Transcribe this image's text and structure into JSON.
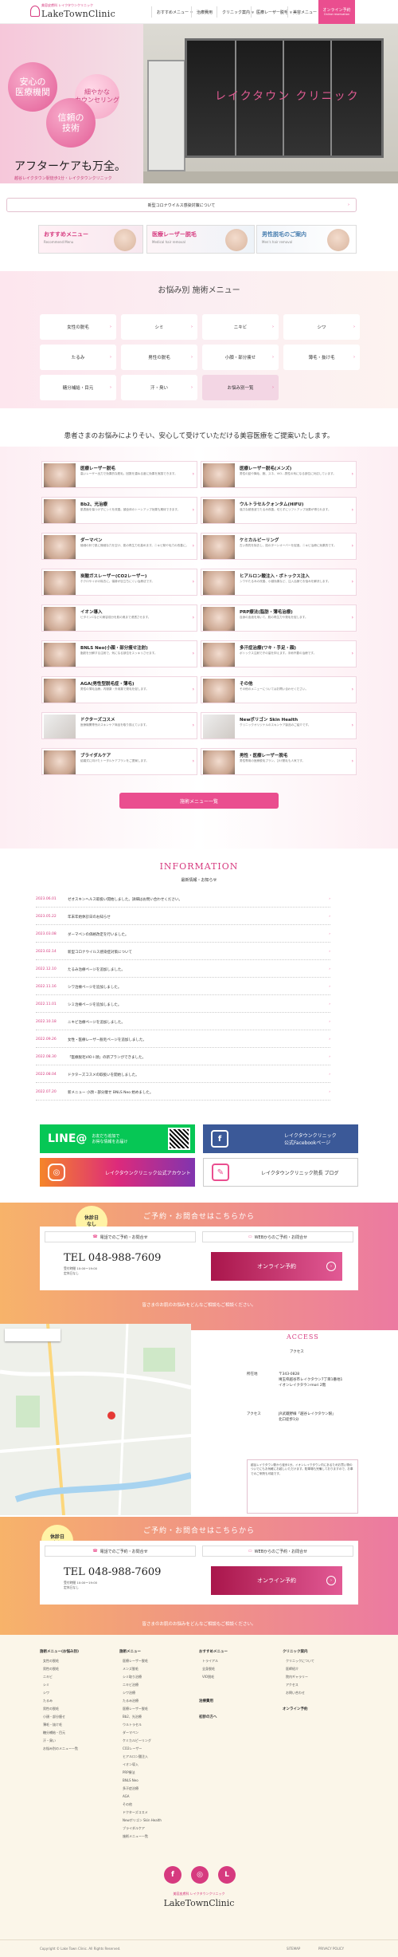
{
  "header": {
    "logo_sub": "美容皮膚科 レイクタウンクリニック",
    "logo": "LakeTownClinic",
    "nav": [
      "おすすめメニュー",
      "治療費用",
      "クリニック案内",
      "医療レーザー脱毛",
      "美容メニュー"
    ],
    "cta": [
      "オンライン予約",
      "Online reservation"
    ]
  },
  "hero": {
    "sign": "レイクタウン クリニック",
    "bubble1": "安心の\n医療機関",
    "bubble2": "細やかな\nカウンセリング",
    "bubble3": "信頼の\n技術",
    "copy": "アフターケアも万全。",
    "copy2": "越谷レイクタウン駅徒歩1分・レイクタウンクリニック"
  },
  "notice": "新型コロナウイルス感染対策について",
  "banners": [
    {
      "t": "おすすめメニュー",
      "s": "Recommend Menu"
    },
    {
      "t": "医療レーザー脱毛",
      "s": "Medical hair removal"
    },
    {
      "t": "男性脱毛のご案内",
      "s": "Men's hair removal"
    }
  ],
  "menu": {
    "title": "お悩み別 施術メニュー",
    "items": [
      "女性の脱毛",
      "シミ",
      "ニキビ",
      "シワ",
      "たるみ",
      "男性の脱毛",
      "小顔・部分痩せ",
      "薄毛・抜け毛",
      "糖分補給・目元",
      "汗・臭い",
      "お悩み別一覧"
    ]
  },
  "proposal": "患者さまのお悩みによりそい、安心して受けていただける美容医療をご提案いたします。",
  "treatments": [
    {
      "n": "医療レーザー脱毛",
      "d": "高いレーザー出力で効果的な脱毛。回数を重ねる度に効果を実感できます。"
    },
    {
      "n": "医療レーザー脱毛(メンズ)",
      "d": "男性の髭や胸毛、腕、スネ、VIO…男性の気になる部位に対応しています。"
    },
    {
      "n": "Bb2、光治療",
      "d": "肌表面を傷つけずにシミを改善。顔全体のトーンアップ効果も期待できます。"
    },
    {
      "n": "ウルトラセルクォンタム(HIFU)",
      "d": "強力な超音波でたるみ改善。切らずにリフトアップ効果が得られます。"
    },
    {
      "n": "ダーマペン",
      "d": "極細の針で肌に微細な穴を空け、肌の再生力を高めます。ニキビ跡や毛穴の改善に。"
    },
    {
      "n": "ケミカルピーリング",
      "d": "古い角質を除去し、肌のターンオーバーを促進。ニキビ治療に効果的です。"
    },
    {
      "n": "炭酸ガスレーザー(CO2レーザー)",
      "d": "ホクロやイボの除去に。傷跡が目立ちにくい治療法です。"
    },
    {
      "n": "ヒアルロン酸注入・ボトックス注入",
      "d": "シワやたるみの改善、小顔効果など、注入治療でお悩みを解決します。"
    },
    {
      "n": "イオン導入",
      "d": "ビタミンCなどの美容成分を肌の奥まで浸透させます。"
    },
    {
      "n": "PRP療法(脂肪・薄毛治療)",
      "d": "自身の血液を用いて、肌の再生力や発毛を促します。"
    },
    {
      "n": "BNLS Neo(小顔・部分痩せ注射)",
      "d": "脂肪を分解する注射で、気になる部位をスッキリさせます。"
    },
    {
      "n": "多汗症治療(ワキ・手足・顔)",
      "d": "ボトックス注射で汗の量を抑えます。手術不要の治療です。"
    },
    {
      "n": "AGA(男性型脱毛症・薄毛)",
      "d": "男性の薄毛治療。内服薬・外用薬で発毛を促します。"
    },
    {
      "n": "その他",
      "d": "その他のメニューについてはお問い合わせください。"
    },
    {
      "n": "ドクターズコスメ",
      "d": "医療機関専売のスキンケア商品を取り揃えています。"
    },
    {
      "n": "Newポリゴン Skin Health",
      "d": "クリニックオリジナルのスキンケア製品のご紹介です。"
    },
    {
      "n": "ブライダルケア",
      "d": "結婚式に向けたトータルケアプランをご提案します。"
    },
    {
      "n": "男性・医療レーザー脱毛",
      "d": "男性専用の医療脱毛プラン。ひげ脱毛も人気です。"
    }
  ],
  "treat_all": "施術メニュー一覧",
  "info": {
    "title": "INFORMATION",
    "sub": "最新情報・お知らせ",
    "news": [
      {
        "d": "2023.06.01",
        "t": "ゼオスキンヘルス取扱い開始しました。詳細はお問い合わせください。"
      },
      {
        "d": "2023.05.22",
        "t": "年末年始休診日のお知らせ"
      },
      {
        "d": "2023.03.08",
        "t": "ダーマペンの価格改定を行いました。"
      },
      {
        "d": "2023.02.14",
        "t": "新型コロナウイルス感染症対策について"
      },
      {
        "d": "2022.12.10",
        "t": "たるみ治療ページを追加しました。"
      },
      {
        "d": "2022.11.16",
        "t": "シワ治療ページを追加しました。"
      },
      {
        "d": "2022.11.01",
        "t": "シミ治療ページを追加しました。"
      },
      {
        "d": "2022.10.18",
        "t": "ニキビ治療ページを追加しました。"
      },
      {
        "d": "2022.09.26",
        "t": "女性・医療レーザー脱毛ページを追加しました。"
      },
      {
        "d": "2022.08.30",
        "t": "「医療脱毛VIO＋顔」の新プランができました。"
      },
      {
        "d": "2022.08.04",
        "t": "ドクターズコスメの取扱いを開始しました。"
      },
      {
        "d": "2022.07.20",
        "t": "新メニュー 小顔・部分痩せ BNLS Neo 始めました。"
      }
    ]
  },
  "sns": {
    "line": "LINE@",
    "line_sub": "お友だち追加で\nお得な情報をお届け",
    "fb": "レイクタウンクリニック\n公式Facebookページ",
    "ig": "レイクタウンクリニック公式アカウント",
    "blog": "レイクタウンクリニック院長 ブログ"
  },
  "contact": {
    "holiday": "休診日\nなし",
    "heading": "ご予約・お問合せはこちらから",
    "tab1": "電話でのご予約・お問合せ",
    "tab2": "WEBからのご予約・お問合せ",
    "tel": "TEL 048-988-7609",
    "hours": "受付時間 10:00～19:00\n定休日なし",
    "online": "オンライン予約",
    "foot": "皆さまのお肌のお悩みをどんなご相談もご相談ください。"
  },
  "access": {
    "title": "ACCESS",
    "name": "アクセス",
    "addr_label": "所在地",
    "addr": "〒343-0828\n埼玉県越谷市レイクタウン7丁目1番地1\nイオンレイクタウンmori 2階",
    "route_label": "アクセス",
    "route": "JR武蔵野線「越谷レイクタウン駅」\n北口徒歩1分",
    "note": "越谷レイクタウン駅から徒歩1分。イオンレイクタウン内にあるためお買い物のついでにもお気軽にお越しいただけます。駐車場も完備しておりますので、お車でのご来院も可能です。"
  },
  "footer": {
    "cols": [
      {
        "h": "施術メニュー(お悩み別)",
        "i": [
          "女性の脱毛",
          "男性の脱毛",
          "ニキビ",
          "シミ",
          "シワ",
          "たるみ",
          "男性の脱毛",
          "小顔・部分痩せ",
          "薄毛・抜け毛",
          "糖分補給・目元",
          "汗・臭い",
          "お悩み別のメニュー一覧"
        ]
      },
      {
        "h": "施術メニュー",
        "i": [
          "医療レーザー脱毛",
          "メンズ脱毛",
          "シミ取り治療",
          "ニキビ治療",
          "シワ治療",
          "たるみ治療",
          "医療レーザー脱毛",
          "Bb2、光治療",
          "ウルトラセル",
          "ダーマペン",
          "ケミカルピーリング",
          "CO2レーザー",
          "ヒアルロン酸注入",
          "イオン導入",
          "PRP療法",
          "BNLS Neo",
          "多汗症治療",
          "AGA",
          "その他",
          "ドクターズコスメ",
          "Newポリゴン Skin Health",
          "ブライダルケア",
          "施術メニュー一覧"
        ]
      },
      {
        "h": "おすすめメニュー",
        "i": [
          "トライアル",
          "全身脱毛",
          "VIO脱毛"
        ]
      },
      {
        "h": "クリニック案内",
        "i": [
          "クリニックについて",
          "医師紹介",
          "院内ギャラリー",
          "アクセス",
          "お問い合わせ"
        ]
      }
    ],
    "col3_more": [
      "治療費用",
      "初診の方へ"
    ],
    "col4_more": "オンライン予約",
    "logo": "LakeTownClinic",
    "logo_sub": "美容皮膚科 レイクタウンクリニック",
    "copyright": "Copyright © Lake Town Clinic. All Rights Reserved.",
    "links": [
      "SITEMAP",
      "PRIVACY POLICY"
    ]
  }
}
